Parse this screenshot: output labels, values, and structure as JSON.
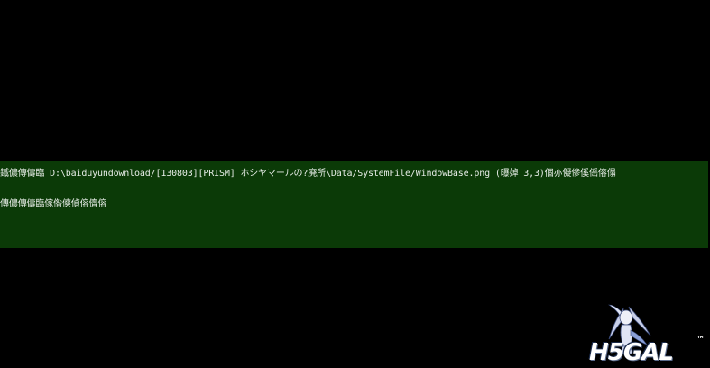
{
  "error_panel": {
    "line1": "鐵儂傳儔臨 D:\\baiduyundownload/[130803][PRISM] ホシヤマールの?廃所\\Data/SystemFile/WindowBase.png (曝婥 3,3)個亦儗傪傒傜傛傝",
    "line2": "傳儂傳儔臨傢偺傸偵傛儕傛"
  },
  "watermark": {
    "text": "H5GAL",
    "tm": "™",
    "logo_colors": {
      "hair": "#c8cfe8",
      "outline": "#3a4a7a",
      "accent": "#8aa0d8"
    }
  }
}
